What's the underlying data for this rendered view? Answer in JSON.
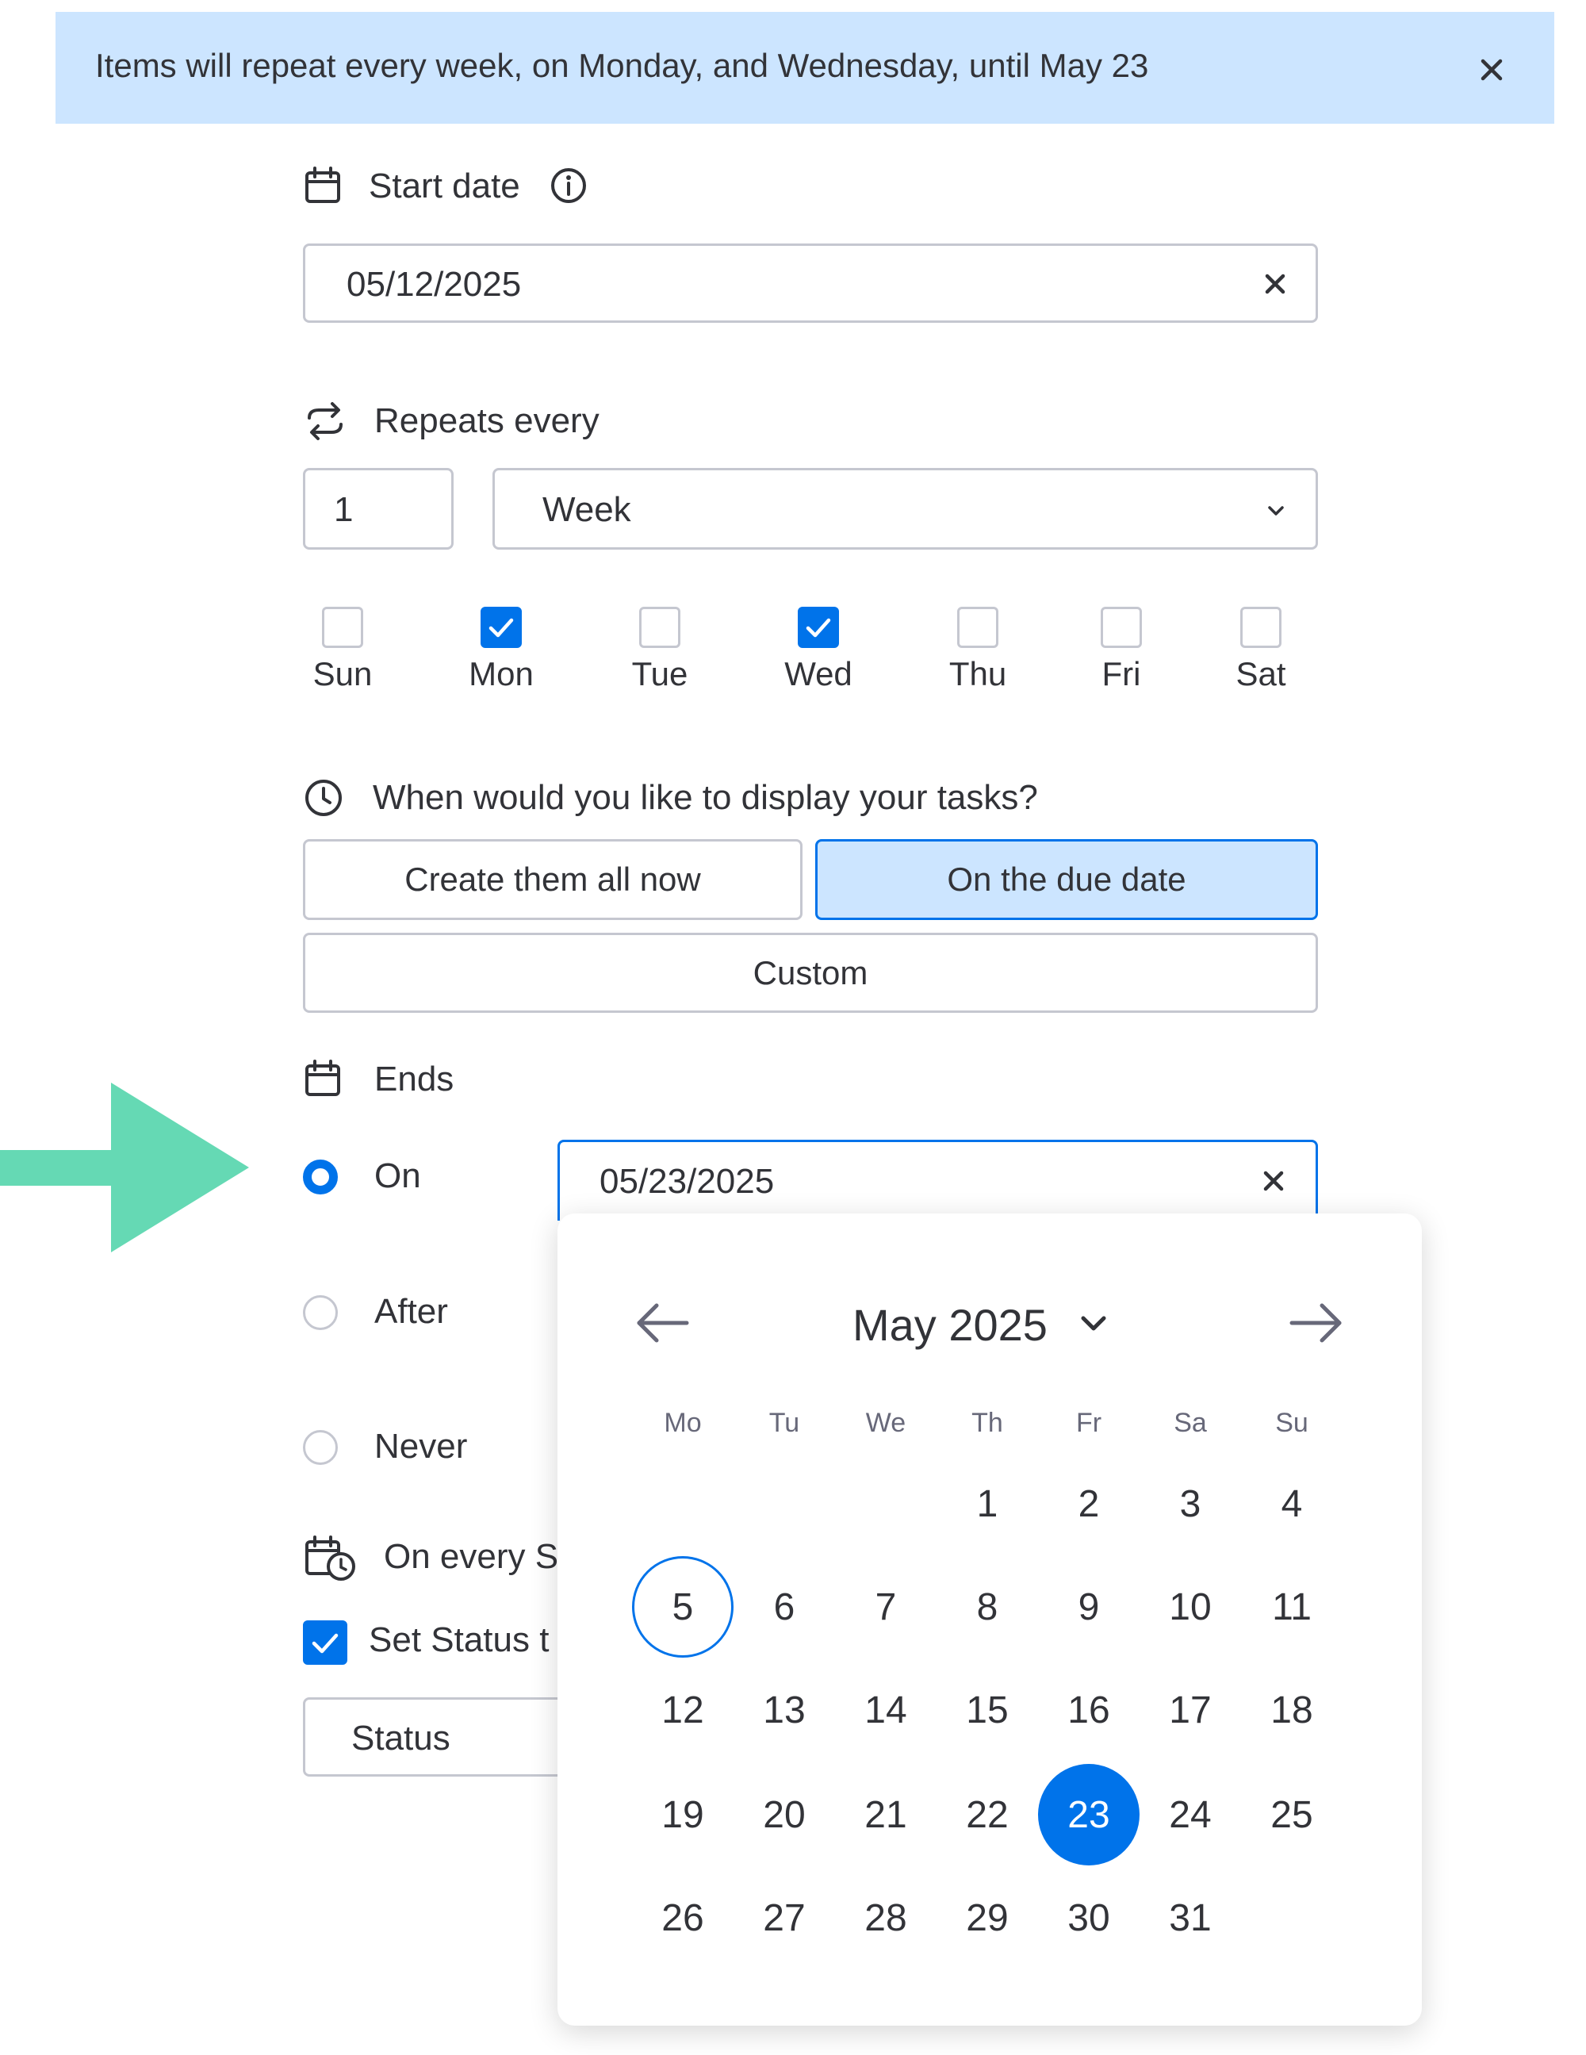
{
  "banner": {
    "text": "Items will repeat every week, on Monday, and Wednesday, until May 23",
    "bg_color": "#cce5ff"
  },
  "start_date": {
    "label": "Start date",
    "value": "05/12/2025"
  },
  "repeat": {
    "label": "Repeats every",
    "interval": "1",
    "unit": "Week",
    "days": [
      {
        "label": "Sun",
        "checked": false
      },
      {
        "label": "Mon",
        "checked": true
      },
      {
        "label": "Tue",
        "checked": false
      },
      {
        "label": "Wed",
        "checked": true
      },
      {
        "label": "Thu",
        "checked": false
      },
      {
        "label": "Fri",
        "checked": false
      },
      {
        "label": "Sat",
        "checked": false
      }
    ]
  },
  "display": {
    "question": "When would you like to display your tasks?",
    "options": [
      "Create them all now",
      "On the due date",
      "Custom"
    ],
    "selected": "On the due date"
  },
  "ends": {
    "label": "Ends",
    "options": [
      "On",
      "After",
      "Never"
    ],
    "selected": "On",
    "date_value": "05/23/2025"
  },
  "on_every": {
    "label": "On every S"
  },
  "set_status": {
    "label": "Set Status t",
    "checked": true,
    "field_value": "Status"
  },
  "calendar": {
    "month_label": "May 2025",
    "weekdays": [
      "Mo",
      "Tu",
      "We",
      "Th",
      "Fr",
      "Sa",
      "Su"
    ],
    "weeks": [
      [
        "",
        "",
        "",
        "1",
        "2",
        "3",
        "4"
      ],
      [
        "5",
        "6",
        "7",
        "8",
        "9",
        "10",
        "11"
      ],
      [
        "12",
        "13",
        "14",
        "15",
        "16",
        "17",
        "18"
      ],
      [
        "19",
        "20",
        "21",
        "22",
        "23",
        "24",
        "25"
      ],
      [
        "26",
        "27",
        "28",
        "29",
        "30",
        "31",
        ""
      ]
    ],
    "today": "5",
    "selected": "23"
  },
  "colors": {
    "accent": "#0073ea",
    "arrow": "#65d9b4",
    "selected_bg": "#cce5ff"
  }
}
